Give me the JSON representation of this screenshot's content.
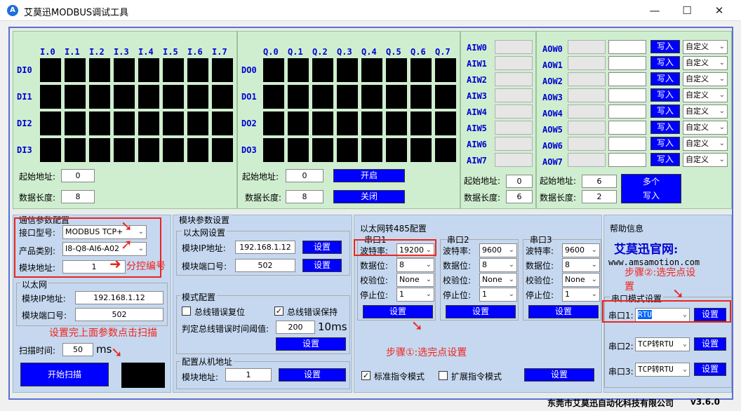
{
  "title": "艾莫迅MODBUS调试工具",
  "logo": "A",
  "win": {
    "min": "—",
    "max": "☐",
    "close": "✕"
  },
  "di": {
    "headers": [
      "I.0",
      "I.1",
      "I.2",
      "I.3",
      "I.4",
      "I.5",
      "I.6",
      "I.7"
    ],
    "rows": [
      "DI0",
      "DI1",
      "DI2",
      "DI3"
    ],
    "start_label": "起始地址:",
    "start": "0",
    "len_label": "数据长度:",
    "len": "8"
  },
  "do": {
    "headers": [
      "Q.0",
      "Q.1",
      "Q.2",
      "Q.3",
      "Q.4",
      "Q.5",
      "Q.6",
      "Q.7"
    ],
    "rows": [
      "DO0",
      "DO1",
      "DO2",
      "DO3"
    ],
    "start_label": "起始地址:",
    "start": "0",
    "len_label": "数据长度:",
    "len": "8",
    "open": "开启",
    "close": "关闭"
  },
  "ai": {
    "rows": [
      "AIW0",
      "AIW1",
      "AIW2",
      "AIW3",
      "AIW4",
      "AIW5",
      "AIW6",
      "AIW7"
    ],
    "start_label": "起始地址:",
    "start": "0",
    "len_label": "数据长度:",
    "len": "6"
  },
  "ao": {
    "rows": [
      "AOW0",
      "AOW1",
      "AOW2",
      "AOW3",
      "AOW4",
      "AOW5",
      "AOW6",
      "AOW7"
    ],
    "write": "写入",
    "mode": "自定义",
    "start_label": "起始地址:",
    "start": "6",
    "len_label": "数据长度:",
    "len": "2",
    "multi1": "多个",
    "multi2": "写入"
  },
  "comm": {
    "title": "通信参数配置",
    "port_label": "接口型号:",
    "port": "MODBUS TCP+",
    "prod_label": "产品类别:",
    "prod": "I8-Q8-AI6-A02",
    "addr_label": "模块地址:",
    "addr": "1",
    "eth_title": "以太网",
    "ip_label": "模块IP地址:",
    "ip": "192.168.1.12",
    "port_no_label": "模块端口号:",
    "port_no": "502",
    "scan_label": "扫描时间:",
    "scan": "50",
    "scan_unit": "ms",
    "start_scan": "开始扫描"
  },
  "module": {
    "title": "模块参数设置",
    "eth_title": "以太网设置",
    "ip_label": "模块IP地址:",
    "ip": "192.168.1.12",
    "port_label": "模块端口号:",
    "port": "502",
    "set": "设置",
    "mode_title": "模式配置",
    "reset": "总线错误复位",
    "hold": "总线错误保持",
    "thr_label": "判定总线错误时间阈值:",
    "thr": "200",
    "thr_unit": "10ms",
    "slave_title": "配置从机地址",
    "slave_label": "模块地址:",
    "slave": "1"
  },
  "rs485": {
    "title": "以太网转485配置",
    "ports": [
      {
        "name": "串口1",
        "baud": "19200",
        "data": "8",
        "parity": "None",
        "stop": "1"
      },
      {
        "name": "串口2",
        "baud": "9600",
        "data": "8",
        "parity": "None",
        "stop": "1"
      },
      {
        "name": "串口3",
        "baud": "9600",
        "data": "8",
        "parity": "None",
        "stop": "1"
      }
    ],
    "baud_label": "波特率:",
    "data_label": "数据位:",
    "parity_label": "校验位:",
    "stop_label": "停止位:",
    "set": "设置",
    "std": "标准指令模式",
    "ext": "扩展指令模式"
  },
  "help": {
    "title": "帮助信息",
    "site_label": "艾莫迅官网:",
    "url": "www.amsamotion.com",
    "serial_title": "串口模式设置",
    "s1_label": "串口1:",
    "s1": "RTU",
    "s2_label": "串口2:",
    "s2": "TCP转RTU",
    "s3_label": "串口3:",
    "s3": "TCP转RTU",
    "set": "设置"
  },
  "ann": {
    "a1": "分控编号",
    "a2": "设置完上面参数点击扫描",
    "a3": "步骤①:选完点设置",
    "a4": "步骤②:选完点设",
    "a5": "置"
  },
  "footer": {
    "company": "东莞市艾莫迅自动化科技有限公司",
    "version": "v3.6.0"
  }
}
